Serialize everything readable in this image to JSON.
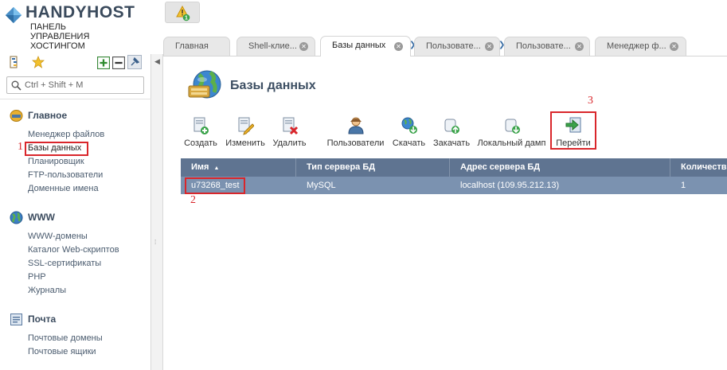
{
  "brand": {
    "name": "HANDYHOST",
    "subtitle": "ПАНЕЛЬ\nУПРАВЛЕНИЯ\nХОСТИНГОМ"
  },
  "alert": {
    "count": "1",
    "icon": "warning-icon"
  },
  "search": {
    "placeholder": "Ctrl + Shift + M"
  },
  "sidebar": {
    "groups": [
      {
        "title": "Главное",
        "icon": "home-db-icon",
        "items": [
          "Менеджер файлов",
          "Базы данных",
          "Планировщик",
          "FTP-пользователи",
          "Доменные имена"
        ]
      },
      {
        "title": "WWW",
        "icon": "globe-icon",
        "items": [
          "WWW-домены",
          "Каталог Web-скриптов",
          "SSL-сертификаты",
          "PHP",
          "Журналы"
        ]
      },
      {
        "title": "Почта",
        "icon": "mail-icon",
        "items": [
          "Почтовые домены",
          "Почтовые ящики"
        ]
      }
    ],
    "active_item": "Базы данных"
  },
  "tabs": [
    {
      "label": "Главная"
    },
    {
      "label": "Shell-клие..."
    },
    {
      "label": "Базы данных"
    },
    {
      "label": "Пользовате..."
    },
    {
      "label": "Пользовате..."
    },
    {
      "label": "Менеджер ф..."
    }
  ],
  "page": {
    "title": "Базы данных"
  },
  "toolbar": {
    "create": "Создать",
    "edit": "Изменить",
    "delete": "Удалить",
    "users": "Пользователи",
    "download": "Скачать",
    "upload": "Закачать",
    "local_dump": "Локальный дамп",
    "go": "Перейти"
  },
  "table": {
    "columns": [
      "Имя",
      "Тип сервера БД",
      "Адрес сервера БД",
      "Количеств"
    ],
    "sort_indicator": "▲",
    "rows": [
      {
        "name": "u73268_test",
        "type": "MySQL",
        "address": "localhost (109.95.212.13)",
        "count": "1"
      }
    ]
  },
  "annotations": {
    "one": "1",
    "two": "2",
    "three": "3"
  },
  "colors": {
    "accent": "#d9262b",
    "header": "#5f7491",
    "row_selected": "#7b92b0",
    "link": "#4a5b6e"
  }
}
